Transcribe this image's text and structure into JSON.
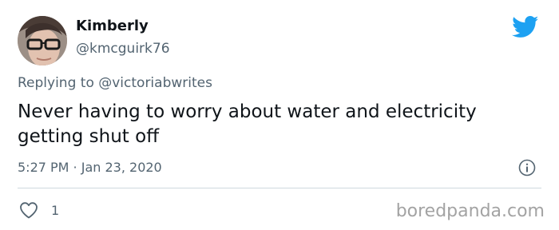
{
  "tweet": {
    "author_name": "Kimberly",
    "author_handle": "@kmcguirk76",
    "replying_prefix": "Replying to",
    "replying_to": "@victoriabwrites",
    "text": "Never having to worry about water and electricity getting shut off",
    "timestamp": "5:27 PM · Jan 23, 2020",
    "like_count": "1"
  },
  "icons": {
    "brand": "twitter-bird-icon",
    "info": "info-icon",
    "like": "heart-icon"
  },
  "colors": {
    "twitter_blue": "#1da1f2",
    "secondary_text": "#536471",
    "divider": "#cfd9de"
  },
  "watermark": "boredpanda.com"
}
